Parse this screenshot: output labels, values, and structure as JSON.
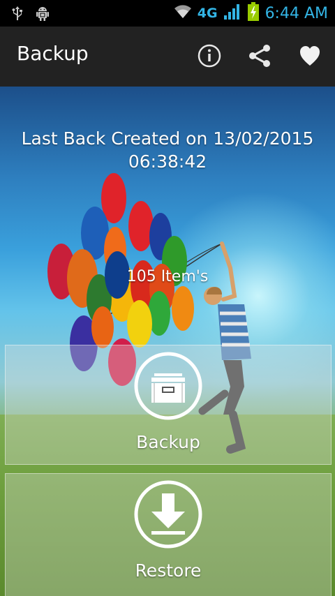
{
  "status_bar": {
    "network": "4G",
    "time": "6:44 AM",
    "accent_color": "#33b5e5",
    "icons": [
      "usb-icon",
      "android-debug-icon",
      "wifi-icon",
      "signal-icon",
      "battery-charging-icon"
    ]
  },
  "action_bar": {
    "title": "Backup",
    "actions": [
      "info-icon",
      "share-icon",
      "heart-icon"
    ]
  },
  "main": {
    "last_backup_line1": "Last Back Created on 13/02/2015",
    "last_backup_line2": "06:38:42",
    "items_count": "105  Item's",
    "backup_button_label": "Backup",
    "restore_button_label": "Restore"
  }
}
